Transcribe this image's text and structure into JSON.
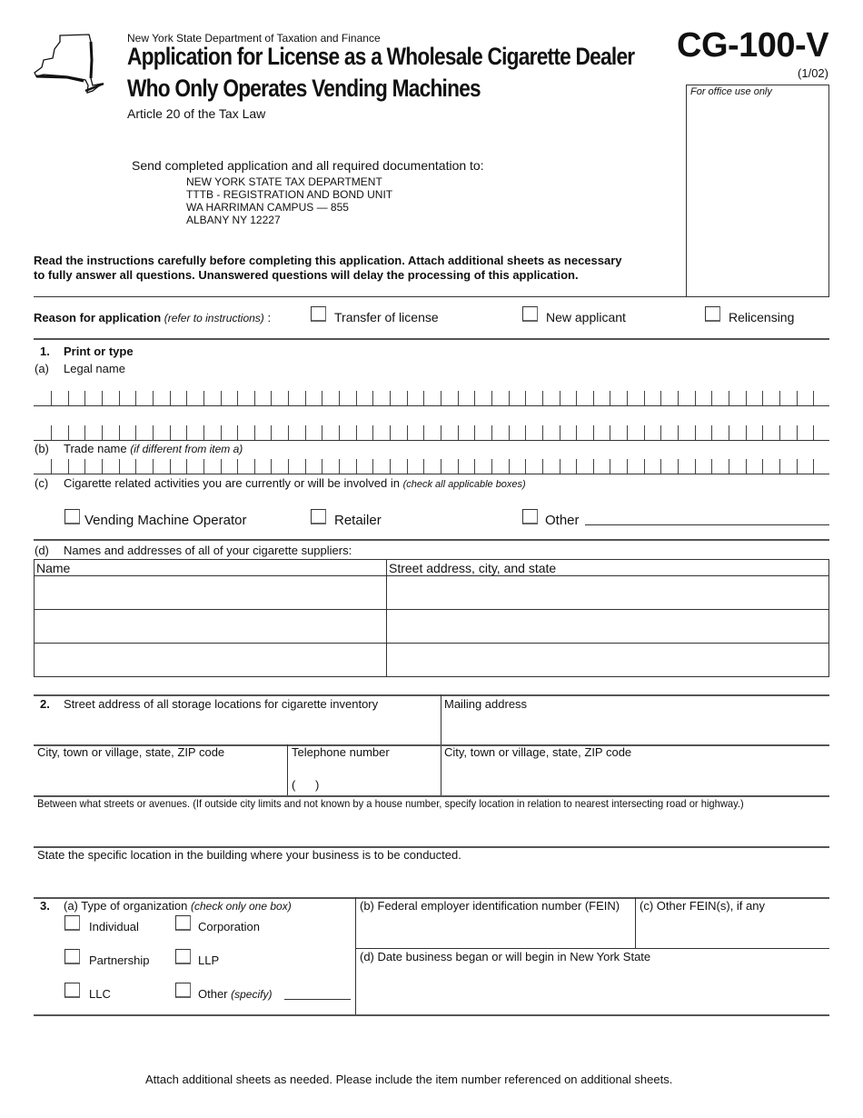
{
  "header": {
    "agency": "New York State Department of Taxation and Finance",
    "title_line1": "Application for License as a Wholesale Cigarette Dealer",
    "title_line2": "Who Only Operates Vending Machines",
    "subtitle": "Article 20 of the Tax Law",
    "form_number": "CG-100-V",
    "revision": "(1/02)",
    "office_use_label": "For office use only"
  },
  "mailing": {
    "intro": "Send completed application and all required documentation to:",
    "address_lines": [
      "NEW YORK STATE TAX DEPARTMENT",
      "TTTB - REGISTRATION AND BOND UNIT",
      "WA HARRIMAN CAMPUS — 855",
      "ALBANY NY 12227"
    ]
  },
  "instructions": {
    "line1": "Read the instructions carefully before completing this application. Attach additional sheets as necessary",
    "line2": "to fully answer all questions. Unanswered questions will delay the processing of this application."
  },
  "reason": {
    "label": "Reason for application",
    "note": "(refer to instructions)",
    "colon": ":",
    "options": [
      {
        "label": "Transfer of license",
        "checked": false
      },
      {
        "label": "New applicant",
        "checked": false
      },
      {
        "label": "Relicensing",
        "checked": false
      }
    ]
  },
  "section1": {
    "number": "1.",
    "heading": "Print or type",
    "a": {
      "letter": "(a)",
      "label": "Legal name",
      "line1": "",
      "line2": ""
    },
    "b": {
      "letter": "(b)",
      "label": "Trade name",
      "note": "(if different from item a)",
      "value": ""
    },
    "c": {
      "letter": "(c)",
      "label": "Cigarette related activities you are currently or will be involved in",
      "note": "(check all applicable boxes)",
      "options": [
        {
          "label": "Vending Machine Operator",
          "checked": false
        },
        {
          "label": "Retailer",
          "checked": false
        },
        {
          "label": "Other",
          "checked": false,
          "value": ""
        }
      ]
    },
    "d": {
      "letter": "(d)",
      "label": "Names and addresses of all of your cigarette suppliers:",
      "columns": [
        "Name",
        "Street address, city, and state"
      ],
      "rows": [
        {
          "name": "",
          "address": ""
        },
        {
          "name": "",
          "address": ""
        },
        {
          "name": "",
          "address": ""
        }
      ]
    }
  },
  "section2": {
    "number": "2.",
    "storage_label": "Street address of all storage locations for cigarette inventory",
    "storage_value": "",
    "mailing_label": "Mailing address",
    "mailing_value": "",
    "city_label": "City, town or village, state, ZIP code",
    "city_value": "",
    "phone_label": "Telephone number",
    "phone_parens": "(      )",
    "phone_value": "",
    "mailing_city_label": "City, town or village, state, ZIP code",
    "mailing_city_value": "",
    "between_label": "Between what streets or avenues. (If outside city limits and not known by a house number, specify location in relation to nearest intersecting road or highway.)",
    "between_value": "",
    "location_label": "State the specific location in the building where your business is to be conducted.",
    "location_value": ""
  },
  "section3": {
    "number": "3.",
    "a": {
      "letter": "(a)",
      "label": "Type of organization",
      "note": "(check only one box)",
      "options": [
        {
          "label": "Individual",
          "checked": false
        },
        {
          "label": "Corporation",
          "checked": false
        },
        {
          "label": "Partnership",
          "checked": false
        },
        {
          "label": "LLP",
          "checked": false
        },
        {
          "label": "LLC",
          "checked": false
        },
        {
          "label": "Other",
          "note": "(specify)",
          "checked": false,
          "value": ""
        }
      ]
    },
    "b": {
      "letter": "(b)",
      "label": "Federal employer identification number (FEIN)",
      "value": ""
    },
    "c": {
      "letter": "(c)",
      "label": "Other FEIN(s), if any",
      "value": ""
    },
    "d": {
      "letter": "(d)",
      "label": "Date business began or will begin in New York State",
      "value": ""
    }
  },
  "footer": {
    "note": "Attach additional sheets as needed.  Please include the item number referenced on additional sheets."
  }
}
